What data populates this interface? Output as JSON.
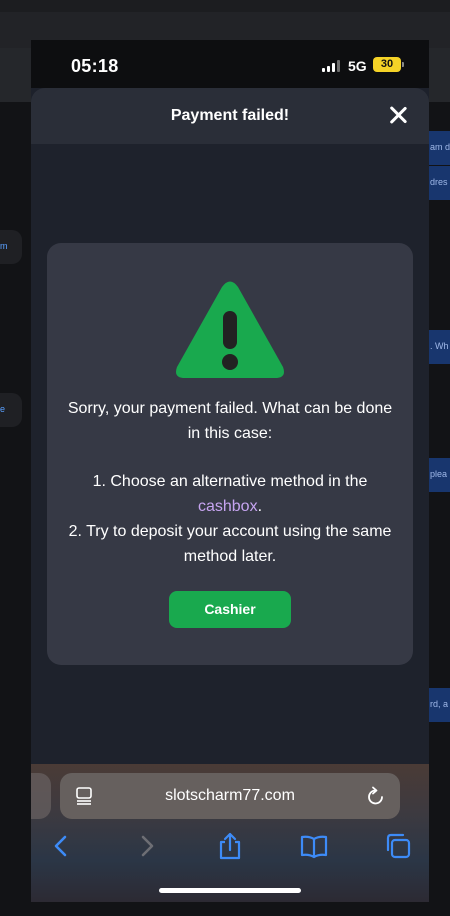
{
  "status_bar": {
    "time": "05:18",
    "network": "5G",
    "battery": "30"
  },
  "modal": {
    "title": "Payment failed!",
    "message": "Sorry, your payment failed. What can be done in this case:",
    "step1_prefix": "1. Choose an alternative method in the",
    "step1_link": "cashbox",
    "step1_suffix": ".",
    "step2": "2. Try to deposit your account using the same method later.",
    "button": "Cashier"
  },
  "browser": {
    "url": "slotscharm77.com"
  },
  "background_snippets": {
    "left": [
      "m",
      "e"
    ],
    "right": [
      "am d",
      "dres",
      ". Wh",
      "plea",
      "rd, a"
    ]
  },
  "colors": {
    "accent_green": "#19a94e",
    "link_purple": "#c6a4f0",
    "ios_blue": "#3d8bf7"
  }
}
